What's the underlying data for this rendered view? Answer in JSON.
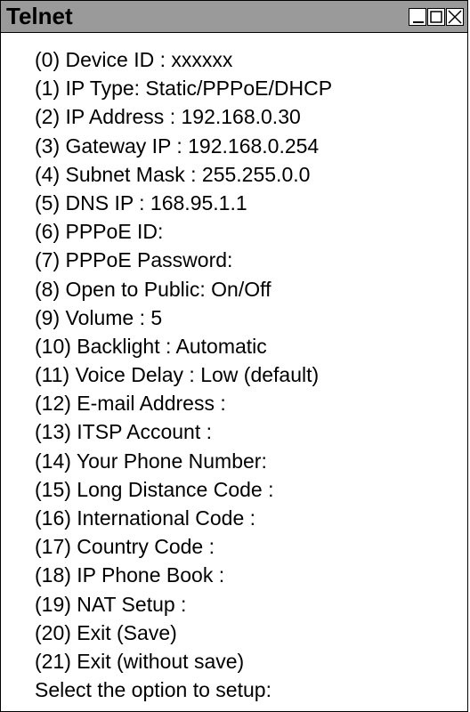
{
  "window": {
    "title": "Telnet",
    "controls": {
      "minimize_icon": "minimize-icon",
      "maximize_icon": "maximize-icon",
      "close_icon": "close-icon"
    }
  },
  "menu": {
    "items": [
      "(0) Device ID : xxxxxx",
      "(1) IP Type: Static/PPPoE/DHCP",
      "(2) IP Address : 192.168.0.30",
      "(3) Gateway IP : 192.168.0.254",
      "(4) Subnet Mask : 255.255.0.0",
      "(5) DNS IP : 168.95.1.1",
      "(6) PPPoE ID:",
      "(7) PPPoE Password:",
      "(8) Open to Public: On/Off",
      "(9) Volume : 5",
      "(10) Backlight : Automatic",
      "(11) Voice Delay : Low (default)",
      "(12) E-mail Address :",
      "(13) ITSP Account :",
      "(14) Your Phone Number:",
      "(15) Long Distance Code :",
      "(16) International Code :",
      "(17) Country Code :",
      "(18) IP Phone Book :",
      "(19) NAT Setup :",
      "(20) Exit (Save)",
      "(21) Exit (without save)"
    ],
    "prompt": "Select the option to setup:"
  }
}
